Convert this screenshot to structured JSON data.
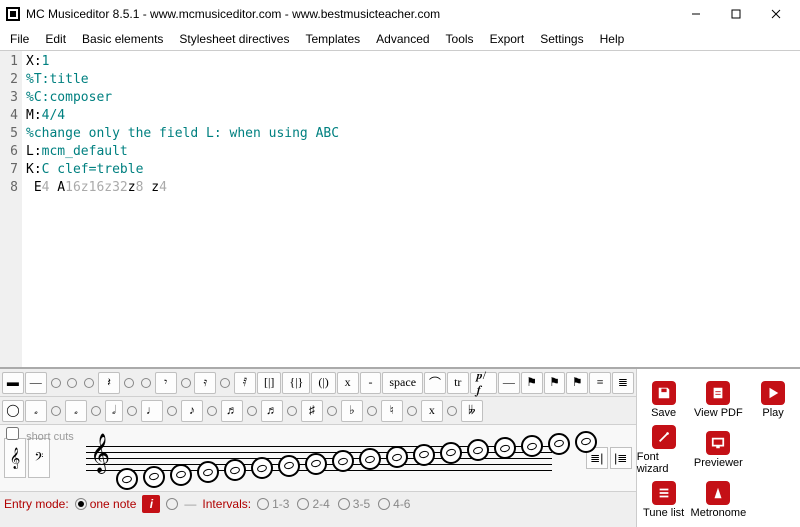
{
  "window": {
    "title": "MC Musiceditor 8.5.1 - www.mcmusiceditor.com - www.bestmusicteacher.com"
  },
  "menubar": [
    "File",
    "Edit",
    "Basic elements",
    "Stylesheet directives",
    "Templates",
    "Advanced",
    "Tools",
    "Export",
    "Settings",
    "Help"
  ],
  "editor": {
    "lines": [
      {
        "n": "1",
        "segments": [
          {
            "t": "X:",
            "c": "tok-black"
          },
          {
            "t": "1",
            "c": "tok-teal"
          }
        ]
      },
      {
        "n": "2",
        "segments": [
          {
            "t": "%T:title",
            "c": "tok-teal"
          }
        ]
      },
      {
        "n": "3",
        "segments": [
          {
            "t": "%C:composer",
            "c": "tok-teal"
          }
        ]
      },
      {
        "n": "4",
        "segments": [
          {
            "t": "M:",
            "c": "tok-black"
          },
          {
            "t": "4/4",
            "c": "tok-teal"
          }
        ]
      },
      {
        "n": "5",
        "segments": [
          {
            "t": "%change only the field L: when using ABC",
            "c": "tok-teal"
          }
        ]
      },
      {
        "n": "6",
        "segments": [
          {
            "t": "L:",
            "c": "tok-black"
          },
          {
            "t": "mcm_default",
            "c": "tok-teal"
          }
        ]
      },
      {
        "n": "7",
        "segments": [
          {
            "t": "K:",
            "c": "tok-black"
          },
          {
            "t": "C clef=treble",
            "c": "tok-teal"
          }
        ]
      },
      {
        "n": "8",
        "segments": [
          {
            "t": " E",
            "c": "tok-black"
          },
          {
            "t": "4",
            "c": "tok-gray"
          },
          {
            "t": " A",
            "c": "tok-black"
          },
          {
            "t": "16",
            "c": "tok-gray"
          },
          {
            "t": "z",
            "c": "tok-gray"
          },
          {
            "t": "16",
            "c": "tok-gray"
          },
          {
            "t": "z",
            "c": "tok-gray"
          },
          {
            "t": "32",
            "c": "tok-gray"
          },
          {
            "t": "z",
            "c": "tok-black"
          },
          {
            "t": "8",
            "c": "tok-gray"
          },
          {
            "t": " z",
            "c": "tok-black"
          },
          {
            "t": "4",
            "c": "tok-gray"
          }
        ]
      }
    ]
  },
  "palette": {
    "row1": [
      "▬",
      "—",
      "○",
      "○",
      "○",
      "𝄽",
      "○",
      "○",
      "𝄾",
      "○",
      "𝄿",
      "○",
      "𝅀",
      "[|]",
      "{|}",
      "(|)",
      "x",
      "-",
      "space",
      "⌒",
      "tr",
      "𝆏/𝆑",
      "—",
      "⚑",
      "⚑",
      "⚑",
      "≡",
      "≣"
    ],
    "row2": [
      "◯",
      "𝅗",
      "○",
      "𝅗",
      "○",
      "𝅗𝅥",
      "○",
      "♩",
      "○",
      "♪",
      "○",
      "♬",
      "○",
      "♬",
      "○",
      "♯",
      "○",
      "♭",
      "○",
      "♮",
      "○",
      "x",
      "○",
      "𝄫"
    ],
    "shortcuts_label": "short cuts",
    "staff_btns_right": [
      "≣|",
      "|≣"
    ]
  },
  "entry": {
    "mode_label": "Entry mode:",
    "mode_value": "one note",
    "marker": "i",
    "intervals_label": "Intervals:",
    "intervals": [
      "1-3",
      "2-4",
      "3-5",
      "4-6"
    ]
  },
  "actions": [
    {
      "key": "save",
      "label": "Save",
      "icon": "save"
    },
    {
      "key": "viewpdf",
      "label": "View PDF",
      "icon": "pdf"
    },
    {
      "key": "play",
      "label": "Play",
      "icon": "play"
    },
    {
      "key": "fontwizard",
      "label": "Font wizard",
      "icon": "wand"
    },
    {
      "key": "previewer",
      "label": "Previewer",
      "icon": "screen"
    },
    {
      "key": "tunelist",
      "label": "Tune list",
      "icon": "list"
    },
    {
      "key": "metronome",
      "label": "Metronome",
      "icon": "metro"
    }
  ]
}
